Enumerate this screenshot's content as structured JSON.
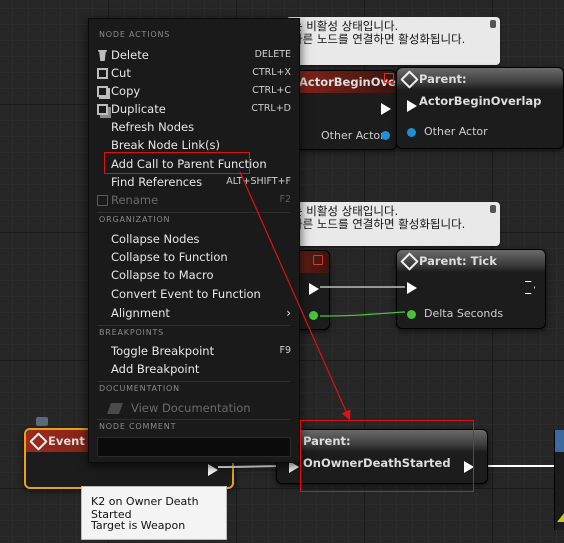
{
  "bubbles": [
    {
      "line1": "는 비활성 상태입니다.",
      "line2": "다른 노드를 연결하면 활성화됩니다."
    },
    {
      "line1": "는 비활성 상태입니다.",
      "line2": "다른 노드를 연결하면 활성화됩니다."
    }
  ],
  "nodes": {
    "event_overlap": {
      "title": "ActorBeginOverlap",
      "pin": "Other Actor"
    },
    "parent_overlap": {
      "title": "Parent: ActorBeginOverlap",
      "pin": "Other Actor"
    },
    "parent_tick": {
      "title": "Parent: Tick",
      "pin": "Delta Seconds"
    },
    "event_death": {
      "title": "Event O"
    },
    "parent_death": {
      "title": "Parent: OnOwnerDeathStarted"
    }
  },
  "menu": {
    "sections": {
      "node_actions": "NODE ACTIONS",
      "organization": "ORGANIZATION",
      "breakpoints": "BREAKPOINTS",
      "documentation": "DOCUMENTATION",
      "node_comment": "NODE COMMENT"
    },
    "items": [
      {
        "label": "Delete",
        "shortcut": "DELETE"
      },
      {
        "label": "Cut",
        "shortcut": "CTRL+X"
      },
      {
        "label": "Copy",
        "shortcut": "CTRL+C"
      },
      {
        "label": "Duplicate",
        "shortcut": "CTRL+D"
      },
      {
        "label": "Refresh Nodes"
      },
      {
        "label": "Break Node Link(s)"
      },
      {
        "label": "Add Call to Parent Function"
      },
      {
        "label": "Find References",
        "shortcut": "ALT+SHIFT+F"
      },
      {
        "label": "Rename",
        "shortcut": "F2"
      },
      {
        "label": "Collapse Nodes"
      },
      {
        "label": "Collapse to Function"
      },
      {
        "label": "Collapse to Macro"
      },
      {
        "label": "Convert Event to Function"
      },
      {
        "label": "Alignment"
      },
      {
        "label": "Toggle Breakpoint",
        "shortcut": "F9"
      },
      {
        "label": "Add Breakpoint"
      },
      {
        "label": "View Documentation"
      }
    ]
  },
  "tooltip": {
    "line1": "K2 on Owner Death Started",
    "line2": "Target is Weapon"
  },
  "colors": {
    "highlight": "#dd1111",
    "selection": "#e8a018",
    "object_pin": "#1f8fd6",
    "float_pin": "#47c43a"
  }
}
